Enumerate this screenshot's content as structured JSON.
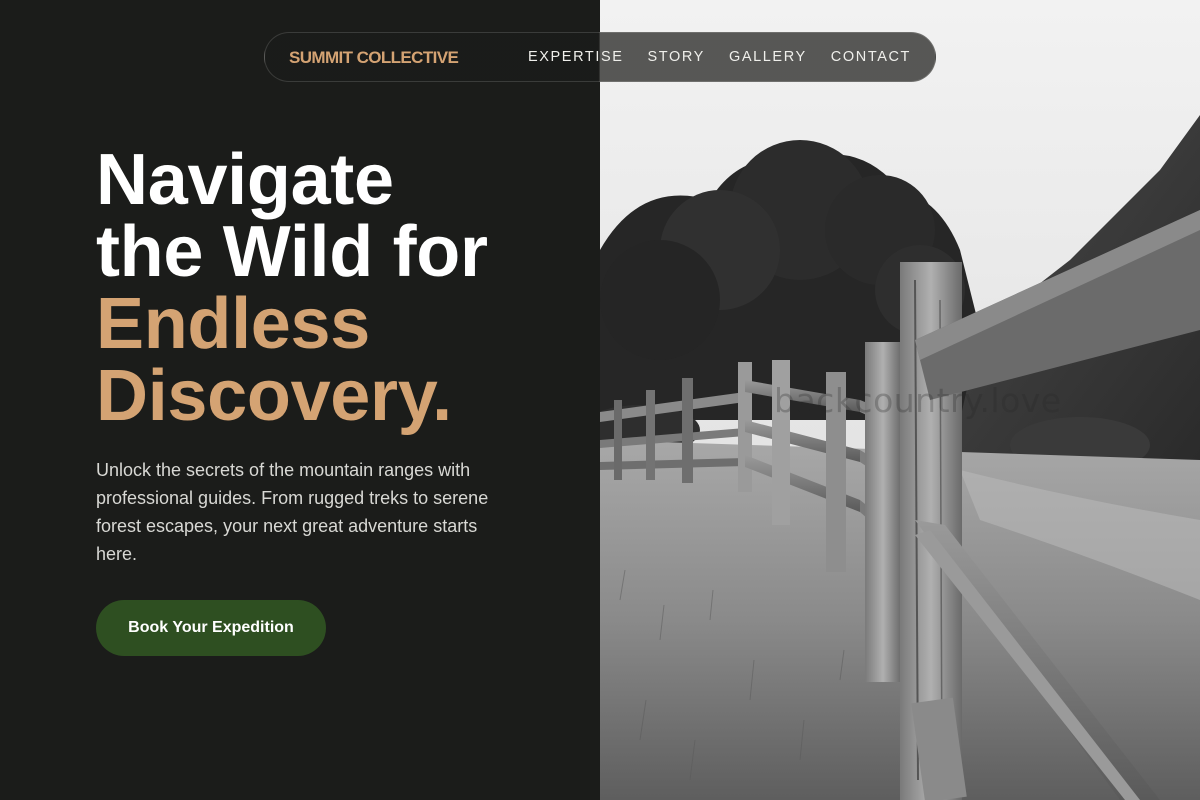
{
  "brand": {
    "name": "SUMMIT COLLECTIVE"
  },
  "nav": {
    "links": [
      {
        "label": "EXPERTISE"
      },
      {
        "label": "STORY"
      },
      {
        "label": "GALLERY"
      },
      {
        "label": "CONTACT"
      }
    ]
  },
  "hero": {
    "title_line1": "Navigate",
    "title_line2": "the Wild for",
    "title_line3": "Endless",
    "title_line4": "Discovery.",
    "description": "Unlock the secrets of the mountain ranges with professional guides. From rugged treks to serene forest escapes, your next great adventure starts here.",
    "cta_label": "Book Your Expedition"
  },
  "image": {
    "watermark": "backcountry.love"
  },
  "colors": {
    "accent": "#d4a373",
    "background": "#1b1c1a",
    "button": "#2e4f21"
  }
}
